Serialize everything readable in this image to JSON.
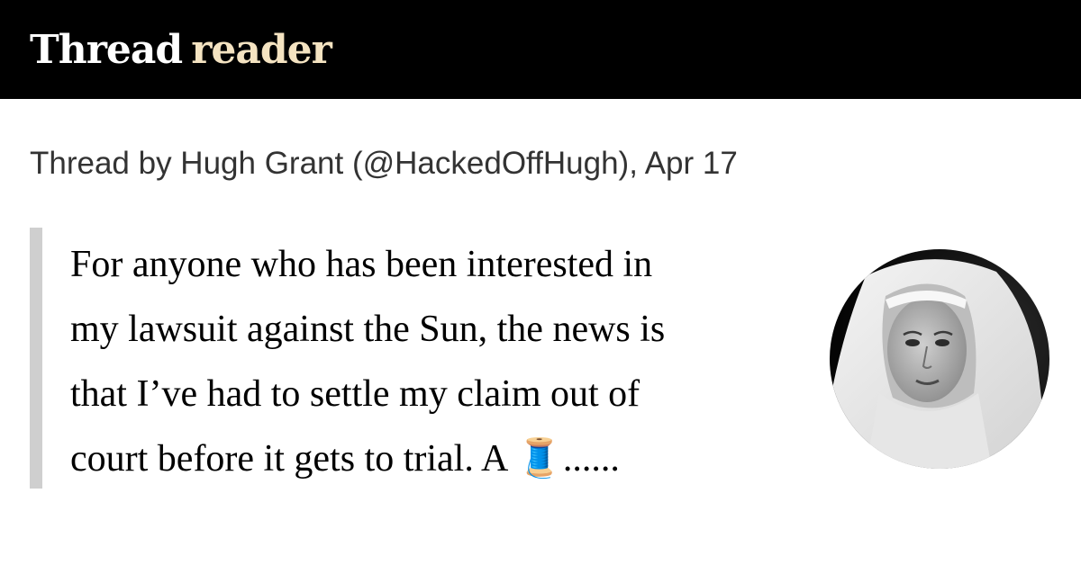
{
  "header": {
    "logo_word_1": "Thread",
    "logo_word_2": "reader"
  },
  "thread": {
    "byline": "Thread by Hugh Grant (@HackedOffHugh), Apr 17",
    "first_tweet_text": "For anyone who has been interested in\nmy lawsuit against the Sun, the news is\nthat  I’ve had to settle my claim out of\ncourt before it gets to trial. A 🧵......"
  },
  "avatar": {
    "icon": "profile-photo-icon"
  },
  "colors": {
    "header_bg": "#000000",
    "logo_primary": "#ffffff",
    "logo_accent": "#f4e3c1",
    "quote_bar": "#cfcfcf",
    "byline_text": "#333333"
  }
}
